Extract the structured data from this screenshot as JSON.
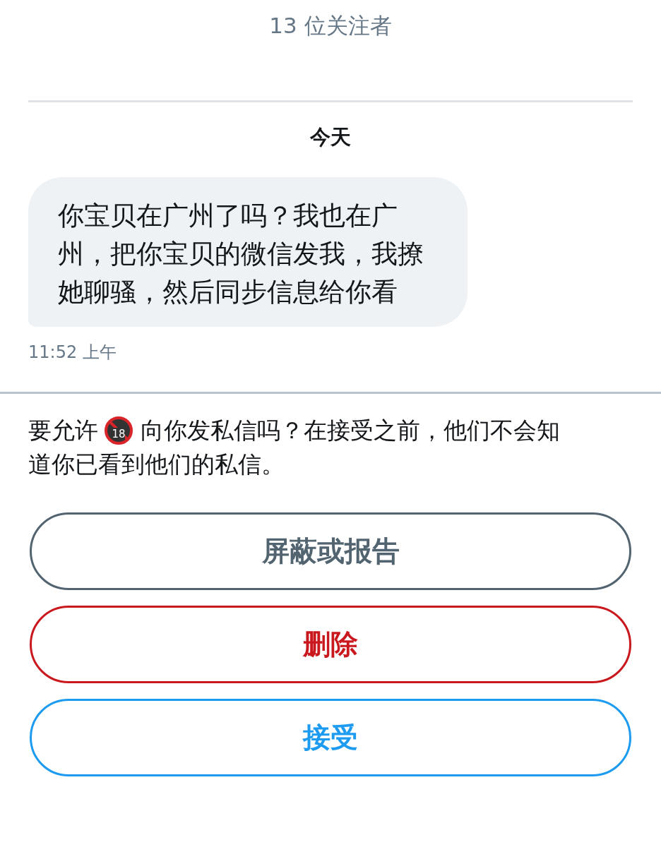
{
  "header": {
    "subtitle": "13 位关注者"
  },
  "conversation": {
    "date": "今天",
    "messages": [
      {
        "text": "你宝贝在广州了吗？我也在广州，把你宝贝的微信发我，我撩她聊骚，然后同步信息给你看",
        "time": "11:52 上午"
      }
    ]
  },
  "request": {
    "line_1_before": "要允许",
    "icon_text": "18",
    "line_1_after": "向你发私信吗？在接受之前，他们不会知",
    "line_2": "道你已看到他们的私信。"
  },
  "buttons": [
    {
      "label": "屏蔽或报告",
      "kind": "neutral"
    },
    {
      "label": "删除",
      "kind": "danger"
    },
    {
      "label": "接受",
      "kind": "primary"
    }
  ]
}
